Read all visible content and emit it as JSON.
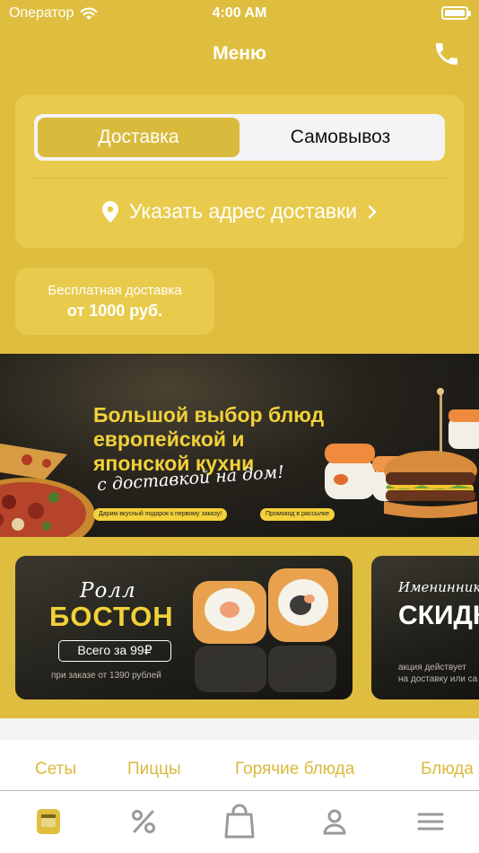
{
  "status_bar": {
    "carrier": "Оператор",
    "time": "4:00 AM"
  },
  "navbar": {
    "title": "Меню"
  },
  "delivery": {
    "tabs": [
      {
        "label": "Доставка",
        "selected": true
      },
      {
        "label": "Самовывоз",
        "selected": false
      }
    ],
    "address_prompt": "Указать адрес доставки"
  },
  "free_delivery": {
    "line1": "Бесплатная доставка",
    "line2": "от 1000 руб."
  },
  "hero_banner": {
    "headline_1": "Большой выбор блюд",
    "headline_2": "европейской и",
    "headline_3": "японской кухни",
    "script": "с доставкой на дом!",
    "pill_1": "Дарим вкусный подарок к первому заказу!",
    "pill_2": "Промокод в рассылке"
  },
  "promo_cards": [
    {
      "title": "Ролл",
      "name": "БОСТОН",
      "price": "Всего за 99₽",
      "note": "при заказе от 1390 рублей"
    },
    {
      "title": "Имениннику",
      "name": "СКИДК",
      "note_1": "акция действует",
      "note_2": "на доставку или са"
    }
  ],
  "categories": [
    "Сеты",
    "Пиццы",
    "Горячие блюда",
    "Блюда"
  ],
  "tab_bar": [
    "menu-icon",
    "percent-icon",
    "bag-icon",
    "profile-icon",
    "more-icon"
  ],
  "colors": {
    "accent": "#dfbe3f",
    "card": "#e8cb4c",
    "category_text": "#d9ba3c",
    "banner_yellow": "#f2d13a"
  }
}
